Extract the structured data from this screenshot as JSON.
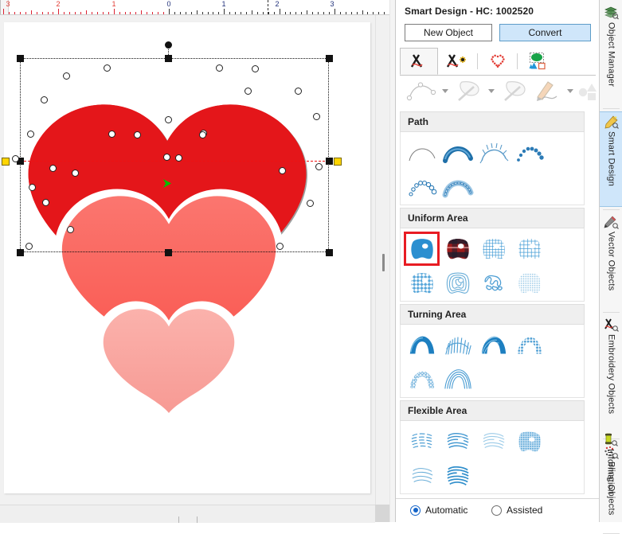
{
  "panel": {
    "title": "Smart Design - HC: 1002520",
    "buttons": {
      "new_object": "New Object",
      "convert": "Convert"
    },
    "tabs": [
      {
        "name": "digitize-open-shape-tab",
        "icon": "pen-stitch-icon",
        "active": true
      },
      {
        "name": "digitize-closed-shape-tab",
        "icon": "pen-stitch-star-icon",
        "active": false
      },
      {
        "name": "auto-outline-tab",
        "icon": "dotted-heart-icon",
        "active": false
      },
      {
        "name": "shape-objects-tab",
        "icon": "shapes-group-icon",
        "active": false
      }
    ],
    "subtools": [
      {
        "name": "curve-node-tool",
        "icon": "bezier-curve-icon",
        "dropdown": true,
        "disabled": true
      },
      {
        "name": "magic-wand-tool",
        "icon": "magic-wand-icon",
        "dropdown": true,
        "disabled": true
      },
      {
        "name": "magic-wand-fill-tool",
        "icon": "magic-wand-fill-icon",
        "dropdown": false,
        "disabled": true
      },
      {
        "name": "freehand-pencil-tool",
        "icon": "pencil-draw-icon",
        "dropdown": true,
        "disabled": true
      },
      {
        "name": "shape-tool",
        "icon": "circle-triangle-square-icon",
        "dropdown": false,
        "disabled": true
      }
    ],
    "sections": [
      {
        "name": "path",
        "heading": "Path",
        "stitch_types": [
          {
            "name": "single-run-stitch",
            "icon": "thin-arc-icon"
          },
          {
            "name": "satin-path-stitch",
            "icon": "solid-arc-icon"
          },
          {
            "name": "comb-path-stitch",
            "icon": "comb-arc-icon"
          },
          {
            "name": "bead-path-stitch",
            "icon": "bead-arc-icon"
          },
          {
            "name": "sequin-path-stitch",
            "icon": "sequin-arc-icon"
          },
          {
            "name": "layered-path-stitch",
            "icon": "layered-arc-icon"
          }
        ]
      },
      {
        "name": "uniform-area",
        "heading": "Uniform Area",
        "selected_index": 0,
        "stitch_types": [
          {
            "name": "solid-fill",
            "icon": "solid-blob-icon"
          },
          {
            "name": "plaid-fill",
            "icon": "plaid-blob-icon"
          },
          {
            "name": "crosshatch-fill",
            "icon": "crosshatch-blob-icon"
          },
          {
            "name": "grid-fill",
            "icon": "grid-blob-icon"
          },
          {
            "name": "lattice-fill",
            "icon": "lattice-blob-icon"
          },
          {
            "name": "contour-fill",
            "icon": "contour-blob-icon"
          },
          {
            "name": "stipple-fill",
            "icon": "stipple-blob-icon"
          },
          {
            "name": "light-texture-fill",
            "icon": "light-texture-blob-icon"
          },
          {
            "name": "gradient-fill",
            "icon": "gradient-blob-icon"
          }
        ]
      },
      {
        "name": "turning-area",
        "heading": "Turning Area",
        "stitch_types": [
          {
            "name": "turning-satin",
            "icon": "solid-dome-icon"
          },
          {
            "name": "turning-comb",
            "icon": "comb-dome-icon"
          },
          {
            "name": "turning-ripple",
            "icon": "ripple-dome-icon"
          },
          {
            "name": "turning-bead",
            "icon": "bead-dome-icon"
          },
          {
            "name": "turning-sequin",
            "icon": "sequin-dome-icon"
          },
          {
            "name": "turning-layered",
            "icon": "layered-dome-icon"
          }
        ]
      },
      {
        "name": "flexible-area",
        "heading": "Flexible Area",
        "stitch_types": [
          {
            "name": "flex-broken-line",
            "icon": "broken-wave-blob-icon"
          },
          {
            "name": "flex-wave",
            "icon": "wave-blob-icon"
          },
          {
            "name": "flex-light-wave",
            "icon": "light-wave-blob-icon"
          },
          {
            "name": "flex-textured-wave",
            "icon": "textured-wave-blob-icon"
          },
          {
            "name": "flex-sparse-wave",
            "icon": "sparse-wave-blob-icon"
          },
          {
            "name": "flex-dense-wave",
            "icon": "dense-wave-blob-icon"
          }
        ]
      }
    ],
    "mode": {
      "options": [
        {
          "name": "automatic",
          "label": "Automatic",
          "selected": true
        },
        {
          "name": "assisted",
          "label": "Assisted",
          "selected": false
        }
      ]
    }
  },
  "side_tabs": [
    {
      "name": "object-manager",
      "label": "Object Manager",
      "icon": "layers-search-icon",
      "active": false
    },
    {
      "name": "smart-design",
      "label": "Smart Design",
      "icon": "magic-wand-sparkle-icon",
      "active": true
    },
    {
      "name": "vector-objects",
      "label": "Vector Objects",
      "icon": "pencil-search-icon",
      "active": false
    },
    {
      "name": "embroidery-objects",
      "label": "Embroidery Objects",
      "icon": "needle-thread-search-icon",
      "active": false
    },
    {
      "name": "bling-objects",
      "label": "Bling Objects",
      "icon": "rhinestone-search-icon",
      "active": false
    },
    {
      "name": "information",
      "label": "Information",
      "icon": "info-spool-search-icon",
      "active": false
    }
  ],
  "canvas": {
    "ruler": {
      "unit_labels_negative": [
        "3",
        "2",
        "1"
      ],
      "unit_labels_positive": [
        "0",
        "1",
        "2",
        "3"
      ],
      "negative_color": "#e23b33",
      "positive_color": "#20307a",
      "marker_position_label": "2"
    },
    "design": {
      "name": "nested-hearts-embroidery",
      "colors": {
        "outer_heart_fill": "#e4161a",
        "outer_heart_stitch": "#1a1a1a",
        "mid_heart_fill": "#fb6a64",
        "inner_heart_fill": "#f9a6a0",
        "page_background": "#ffffff"
      },
      "selection": {
        "handle_color": "#111111",
        "rotate_handle_color": "#ffd500",
        "node_color": "#ffffff",
        "start_marker_color": "#00c000"
      }
    }
  }
}
